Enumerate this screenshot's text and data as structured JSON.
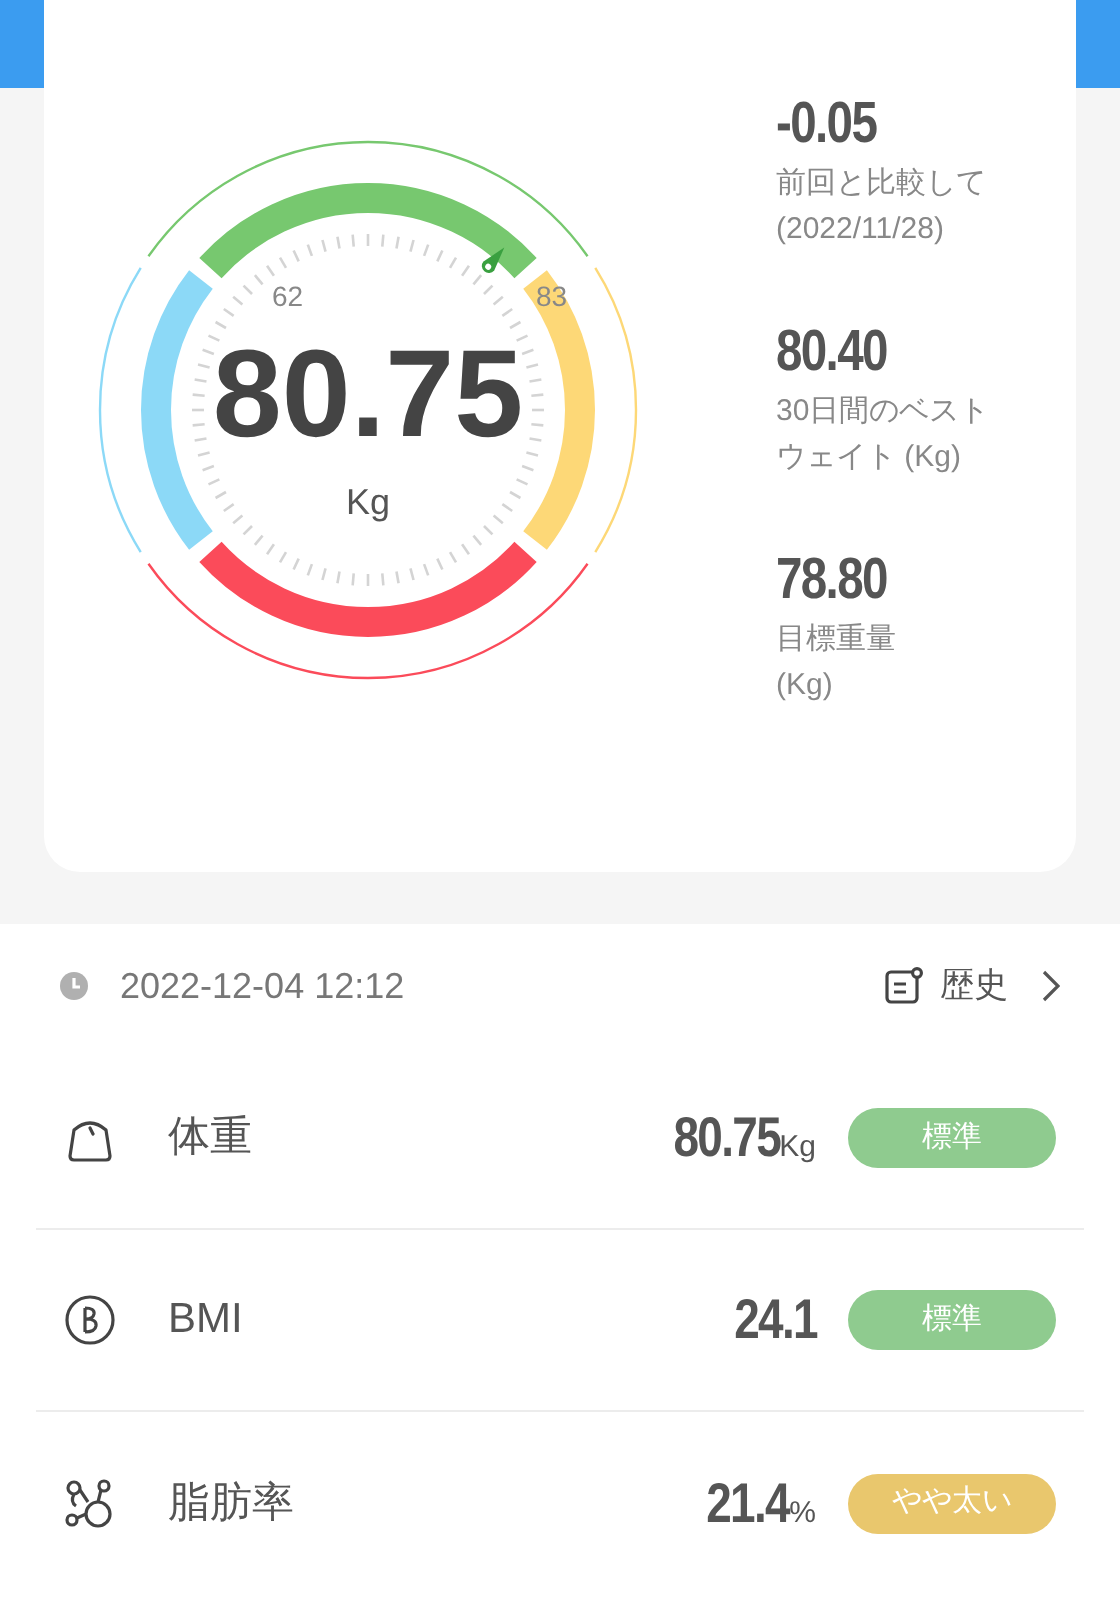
{
  "gauge": {
    "min_label": "62",
    "max_label": "83",
    "value": "80.75",
    "unit": "Kg"
  },
  "stats": [
    {
      "value": "-0.05",
      "label_lines": [
        "前回と比較して",
        "(2022/11/28)"
      ]
    },
    {
      "value": "80.40",
      "label_lines": [
        "30日間のベスト",
        "ウェイト (Kg)"
      ]
    },
    {
      "value": "78.80",
      "label_lines": [
        "目標重量",
        "(Kg)"
      ]
    }
  ],
  "measured_at": "2022-12-04 12:12",
  "history_link": "歴史",
  "metrics": [
    {
      "kind": "weight",
      "label": "体重",
      "value": "80.75",
      "unit": "Kg",
      "badge": "標準",
      "color": "#8fcb8f"
    },
    {
      "kind": "bmi",
      "label": "BMI",
      "value": "24.1",
      "badge": "標準",
      "color": "#8fcb8f"
    },
    {
      "kind": "fat",
      "label": "脂肪率",
      "value": "21.4",
      "unit": "%",
      "badge": "やや太い",
      "color": "#e9c76d"
    }
  ]
}
